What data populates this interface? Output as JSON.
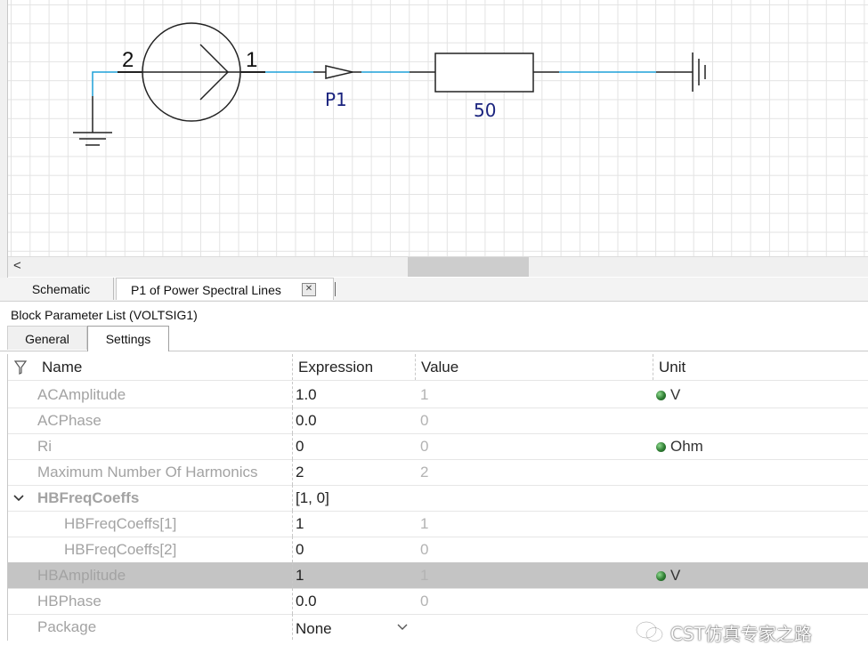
{
  "schematic": {
    "source_pin_left": "2",
    "source_pin_right": "1",
    "port_label": "P1",
    "resistor_value": "50"
  },
  "document_tabs": [
    {
      "label": "Schematic"
    },
    {
      "label": "P1 of Power Spectral Lines"
    }
  ],
  "panel": {
    "title": "Block Parameter List (VOLTSIG1)",
    "tabs": [
      {
        "label": "General"
      },
      {
        "label": "Settings"
      }
    ]
  },
  "table": {
    "headers": {
      "name": "Name",
      "expression": "Expression",
      "value": "Value",
      "unit": "Unit"
    },
    "rows": [
      {
        "name": "ACAmplitude",
        "expression": "1.0",
        "value": "1",
        "unit": "V"
      },
      {
        "name": "ACPhase",
        "expression": "0.0",
        "value": "0",
        "unit": ""
      },
      {
        "name": "Ri",
        "expression": "0",
        "value": "0",
        "unit": "Ohm"
      },
      {
        "name": "Maximum Number Of Harmonics",
        "expression": "2",
        "value": "2",
        "unit": ""
      },
      {
        "name": "HBFreqCoeffs",
        "expression": "[1, 0]",
        "value": "",
        "unit": ""
      },
      {
        "name": "HBFreqCoeffs[1]",
        "expression": "1",
        "value": "1",
        "unit": ""
      },
      {
        "name": "HBFreqCoeffs[2]",
        "expression": "0",
        "value": "0",
        "unit": ""
      },
      {
        "name": "HBAmplitude",
        "expression": "1",
        "value": "1",
        "unit": "V"
      },
      {
        "name": "HBPhase",
        "expression": "0.0",
        "value": "0",
        "unit": ""
      },
      {
        "name": "Package",
        "expression": "None",
        "value": "",
        "unit": ""
      }
    ]
  },
  "watermark": {
    "text": "CST仿真专家之路"
  },
  "colors": {
    "wire": "#1ea0d8",
    "label_blue": "#1a237e",
    "selected_row": "#c4c4c4",
    "grid_line": "#e3e3e3"
  }
}
